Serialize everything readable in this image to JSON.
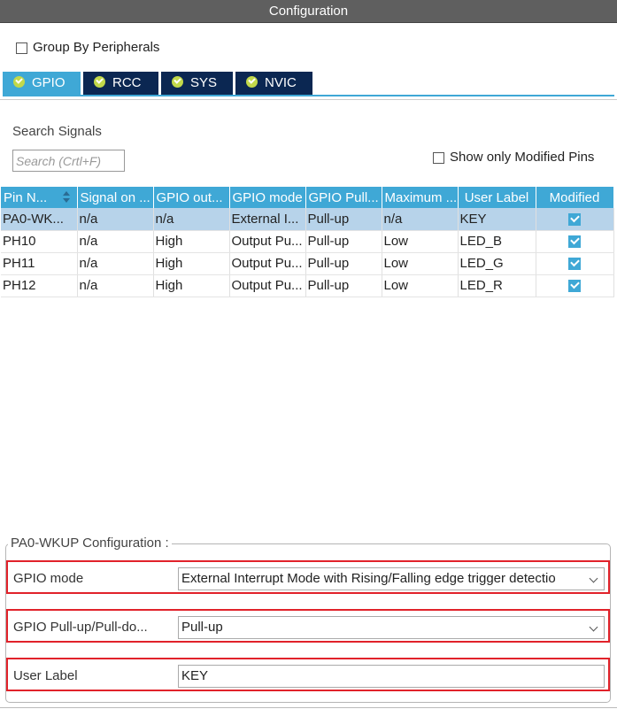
{
  "window": {
    "title": "Configuration"
  },
  "group_by": {
    "label": "Group By Peripherals",
    "checked": false
  },
  "tabs": [
    {
      "label": "GPIO",
      "active": true,
      "icon": "check-circle-icon"
    },
    {
      "label": "RCC",
      "active": false,
      "icon": "check-circle-icon"
    },
    {
      "label": "SYS",
      "active": false,
      "icon": "check-circle-icon"
    },
    {
      "label": "NVIC",
      "active": false,
      "icon": "check-circle-icon"
    }
  ],
  "search": {
    "label": "Search Signals",
    "placeholder": "Search (Crtl+F)",
    "value": ""
  },
  "show_modified": {
    "label": "Show only Modified Pins",
    "checked": false
  },
  "table": {
    "headers": [
      "Pin N...",
      "Signal on ...",
      "GPIO out...",
      "GPIO mode",
      "GPIO Pull...",
      "Maximum ...",
      "User Label",
      "Modified"
    ],
    "rows": [
      {
        "pin": "PA0-WK...",
        "signal": "n/a",
        "output": "n/a",
        "mode": "External I...",
        "pull": "Pull-up",
        "max": "n/a",
        "label": "KEY",
        "modified": true,
        "selected": true
      },
      {
        "pin": "PH10",
        "signal": "n/a",
        "output": "High",
        "mode": "Output Pu...",
        "pull": "Pull-up",
        "max": "Low",
        "label": "LED_B",
        "modified": true,
        "selected": false
      },
      {
        "pin": "PH11",
        "signal": "n/a",
        "output": "High",
        "mode": "Output Pu...",
        "pull": "Pull-up",
        "max": "Low",
        "label": "LED_G",
        "modified": true,
        "selected": false
      },
      {
        "pin": "PH12",
        "signal": "n/a",
        "output": "High",
        "mode": "Output Pu...",
        "pull": "Pull-up",
        "max": "Low",
        "label": "LED_R",
        "modified": true,
        "selected": false
      }
    ]
  },
  "config": {
    "title": "PA0-WKUP Configuration :",
    "gpio_mode": {
      "label": "GPIO mode",
      "value": "External Interrupt Mode with Rising/Falling edge trigger detectio"
    },
    "pull": {
      "label": "GPIO Pull-up/Pull-do...",
      "value": "Pull-up"
    },
    "user_label": {
      "label": "User Label",
      "value": "KEY"
    }
  },
  "colors": {
    "accent": "#3fa8d6",
    "tab_dark": "#0b2752",
    "highlight": "#e1222a",
    "selected_row": "#b7d3ea"
  }
}
